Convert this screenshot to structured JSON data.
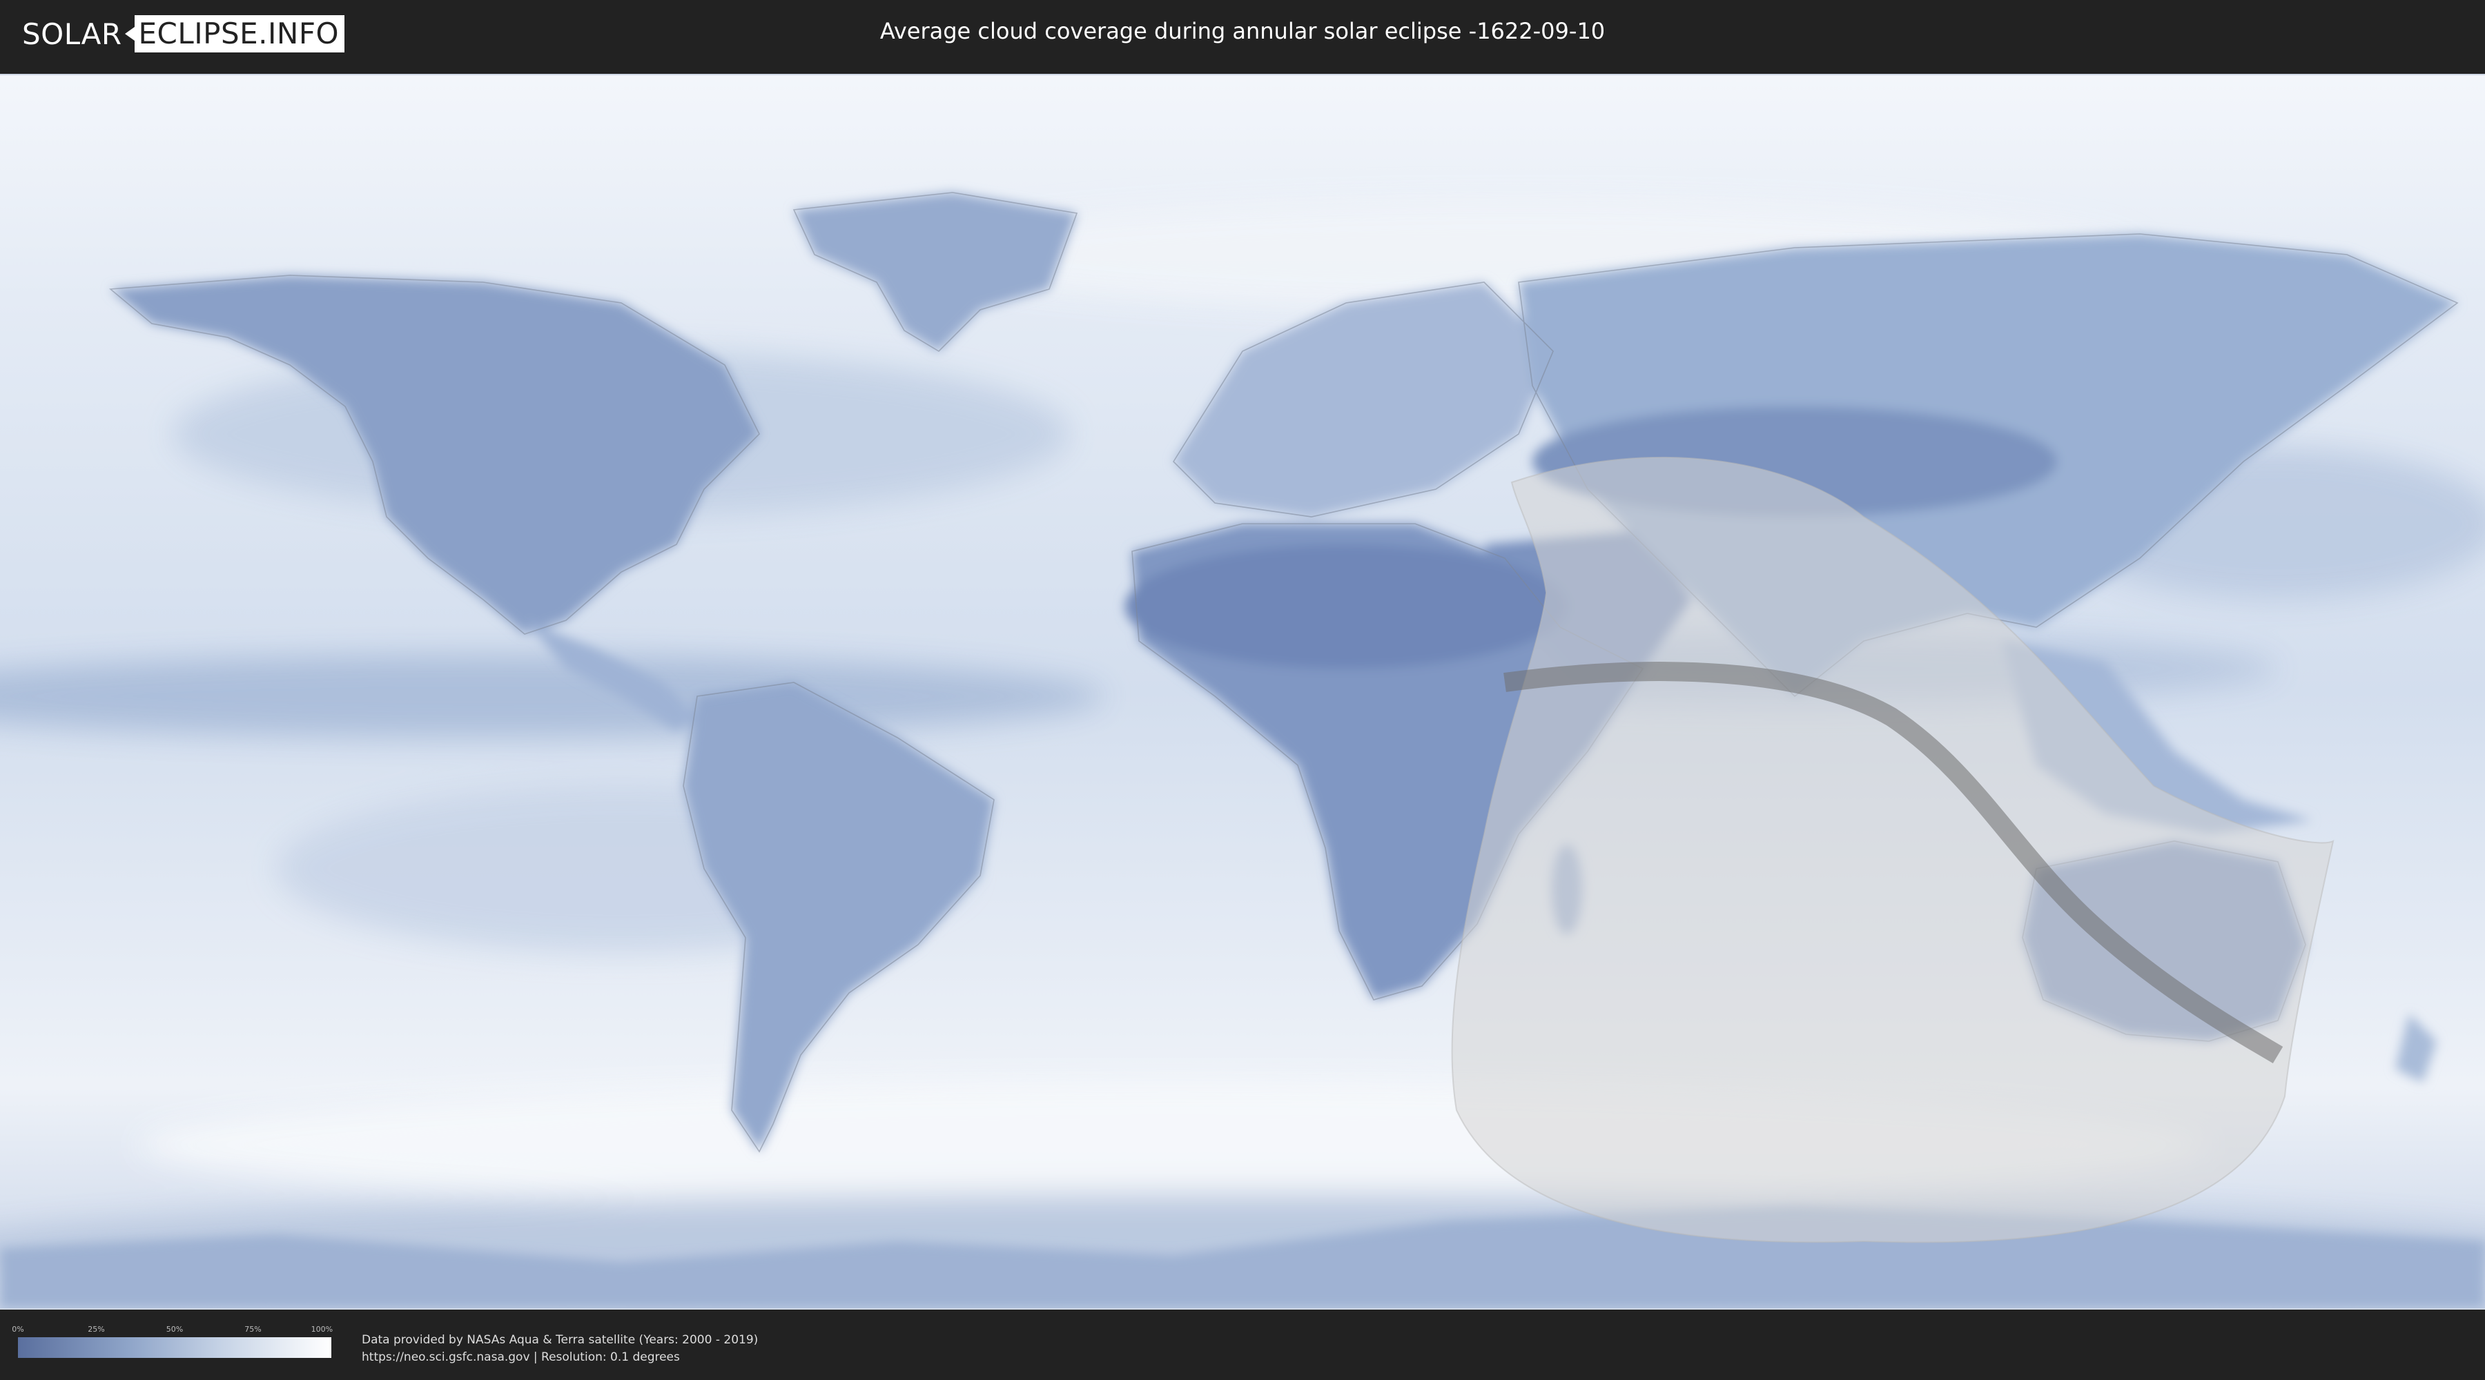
{
  "header": {
    "logo_left": "SOLAR",
    "logo_right": "ECLIPSE.INFO",
    "title": "Average cloud coverage during annular solar eclipse -1622-09-10"
  },
  "legend": {
    "ticks": [
      "0%",
      "25%",
      "50%",
      "75%",
      "100%"
    ],
    "color_low": "#5a6f9e",
    "color_high": "#ffffff"
  },
  "footer": {
    "credit_line1": "Data provided by NASAs Aqua & Terra satellite (Years: 2000 - 2019)",
    "credit_line2": "https://neo.sci.gsfc.nasa.gov | Resolution: 0.1 degrees"
  },
  "colors": {
    "background": "#222222",
    "cloud_clear": "#5a6f9e",
    "cloud_full": "#ffffff",
    "eclipse_zone": "#cfcfcf",
    "central_line": "#707070"
  }
}
